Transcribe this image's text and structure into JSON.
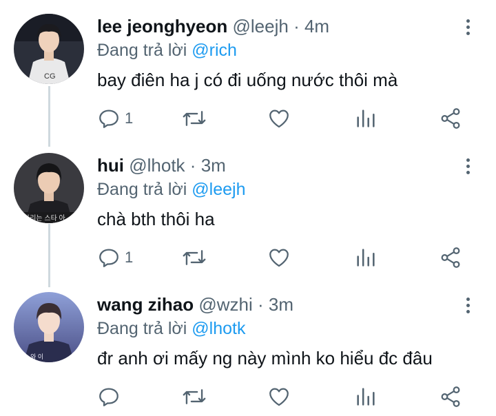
{
  "tweets": [
    {
      "name": "lee jeonghyeon",
      "handle": "@leejh",
      "time": "4m",
      "reply_prefix": "Đang trả lời",
      "reply_to": "@rich",
      "text": "bay điên ha j có đi uống nước thôi mà",
      "reply_count": "1",
      "avatar_bg": "#2b2f3a"
    },
    {
      "name": "hui",
      "handle": "@lhotk",
      "time": "3m",
      "reply_prefix": "Đang trả lời",
      "reply_to": "@leejh",
      "text": "chà bth thôi ha",
      "reply_count": "1",
      "avatar_bg": "#3a3a3f"
    },
    {
      "name": "wang zihao",
      "handle": "@wzhi",
      "time": "3m",
      "reply_prefix": "Đang trả lời",
      "reply_to": "@lhotk",
      "text": "đr anh ơi mấy ng này mình ko hiểu đc đâu",
      "reply_count": "",
      "avatar_bg": "#6f7fb8"
    }
  ],
  "separator": "·",
  "icons": [
    "reply-icon",
    "retweet-icon",
    "like-icon",
    "analytics-icon",
    "share-icon",
    "more-icon"
  ],
  "colors": {
    "accent": "#1d9bf0",
    "muted": "#536471",
    "text": "#0f1419",
    "thread_line": "#cfd9de"
  }
}
